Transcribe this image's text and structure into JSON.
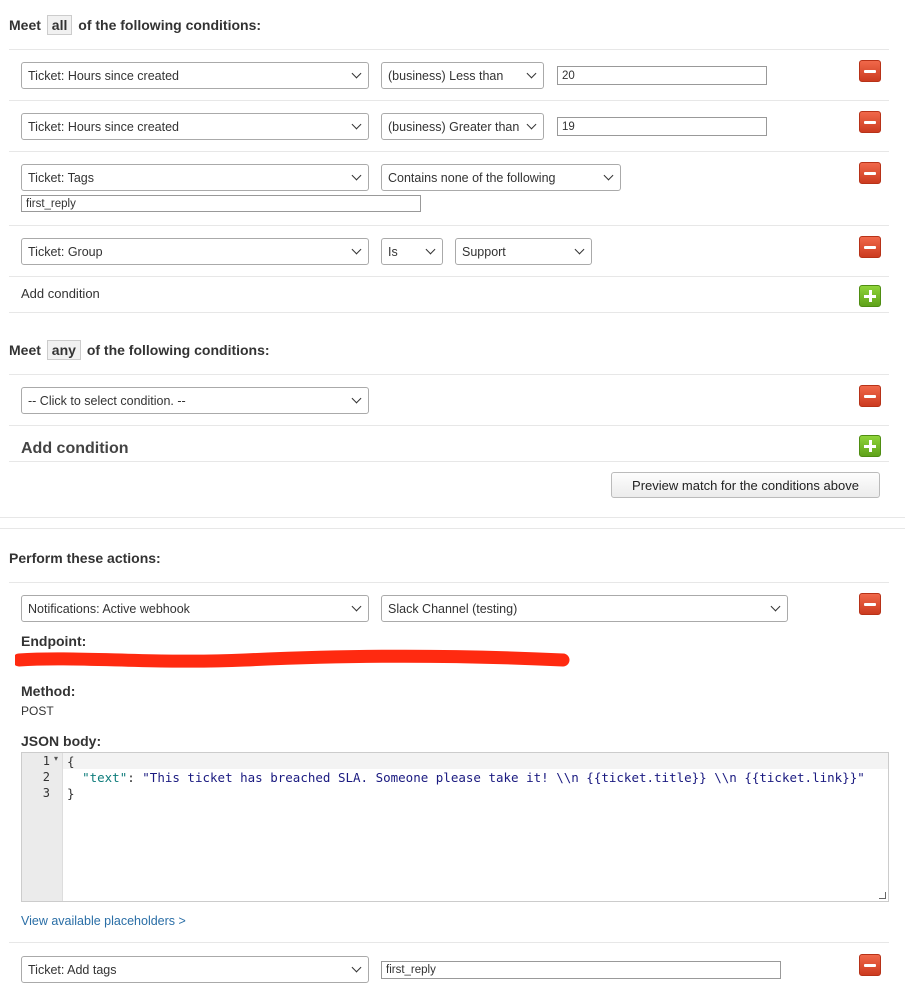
{
  "all_section": {
    "prefix": "Meet",
    "keyword": "all",
    "suffix": "of the following conditions:",
    "conditions": [
      {
        "field": "Ticket: Hours since created",
        "operator": "(business) Less than",
        "value": "20"
      },
      {
        "field": "Ticket: Hours since created",
        "operator": "(business) Greater than",
        "value": "19"
      },
      {
        "field": "Ticket: Tags",
        "operator": "Contains none of the following",
        "value": "first_reply"
      },
      {
        "field": "Ticket: Group",
        "operator": "Is",
        "value": "Support"
      }
    ],
    "add_condition": "Add condition"
  },
  "any_section": {
    "prefix": "Meet",
    "keyword": "any",
    "suffix": "of the following conditions:",
    "conditions": [
      {
        "field": "-- Click to select condition. --"
      }
    ],
    "add_condition": "Add condition"
  },
  "preview_button": "Preview match for the conditions above",
  "actions": {
    "heading": "Perform these actions:",
    "webhook": {
      "field": "Notifications: Active webhook",
      "target": "Slack Channel (testing)",
      "endpoint_label": "Endpoint:",
      "method_label": "Method:",
      "method_value": "POST",
      "json_label": "JSON body:",
      "code_line_numbers": [
        "1",
        "2",
        "3"
      ],
      "code": {
        "open": "{",
        "key": "\"text\"",
        "sep": ": ",
        "value": "\"This ticket has breached SLA. Someone please take it! \\\\n {{ticket.title}} \\\\n {{ticket.link}}\"",
        "close": "}"
      },
      "placeholders_link": "View available placeholders >"
    },
    "add_tags": {
      "field": "Ticket: Add tags",
      "value": "first_reply"
    }
  },
  "colors": {
    "remove_button": "#e0502f",
    "add_button": "#76bb2a",
    "link": "#2a6ea6",
    "redaction": "#ff2a10"
  },
  "icons": {
    "remove": "minus-icon",
    "add": "plus-icon",
    "dropdown": "chevron-down-icon"
  }
}
